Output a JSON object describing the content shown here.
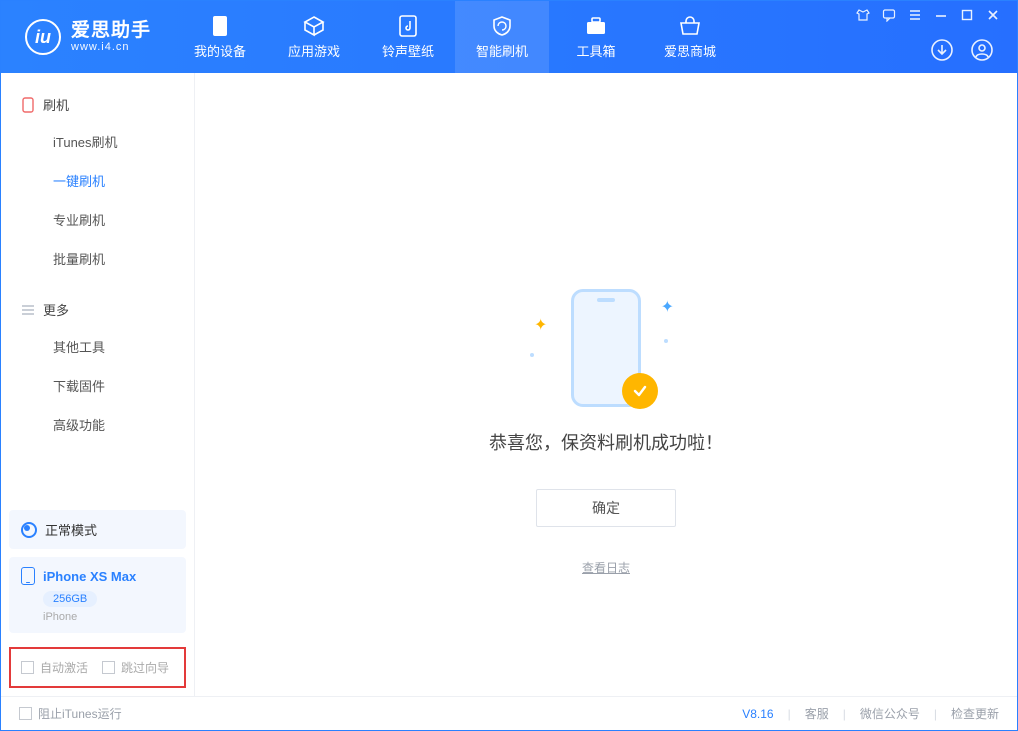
{
  "app": {
    "title": "爱思助手",
    "subtitle": "www.i4.cn",
    "logo_glyph": "iu"
  },
  "topnav": [
    {
      "label": "我的设备"
    },
    {
      "label": "应用游戏"
    },
    {
      "label": "铃声壁纸"
    },
    {
      "label": "智能刷机",
      "active": true
    },
    {
      "label": "工具箱"
    },
    {
      "label": "爱思商城"
    }
  ],
  "sidebar": {
    "section1_title": "刷机",
    "section1_items": [
      {
        "label": "iTunes刷机"
      },
      {
        "label": "一键刷机",
        "active": true
      },
      {
        "label": "专业刷机"
      },
      {
        "label": "批量刷机"
      }
    ],
    "section2_title": "更多",
    "section2_items": [
      {
        "label": "其他工具"
      },
      {
        "label": "下载固件"
      },
      {
        "label": "高级功能"
      }
    ],
    "mode_label": "正常模式",
    "device": {
      "name": "iPhone XS Max",
      "capacity": "256GB",
      "type": "iPhone"
    },
    "opts": {
      "auto_activate": "自动激活",
      "skip_guide": "跳过向导"
    }
  },
  "main": {
    "success_msg": "恭喜您，保资料刷机成功啦！",
    "ok_label": "确定",
    "log_link": "查看日志"
  },
  "status": {
    "block_itunes": "阻止iTunes运行",
    "version": "V8.16",
    "support": "客服",
    "wechat": "微信公众号",
    "update": "检查更新"
  }
}
